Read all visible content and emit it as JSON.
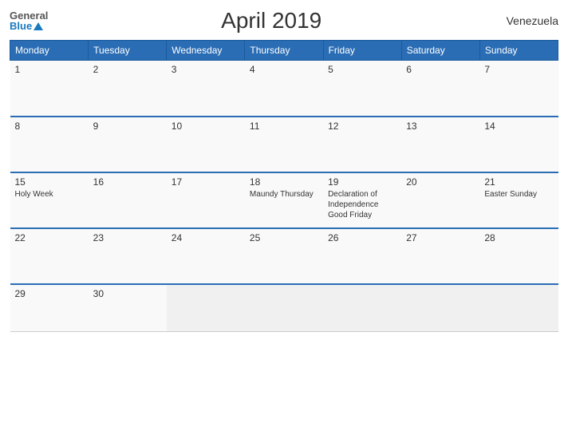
{
  "header": {
    "title": "April 2019",
    "country": "Venezuela"
  },
  "logo": {
    "general": "General",
    "blue": "Blue"
  },
  "days_of_week": [
    "Monday",
    "Tuesday",
    "Wednesday",
    "Thursday",
    "Friday",
    "Saturday",
    "Sunday"
  ],
  "weeks": [
    [
      {
        "day": "1",
        "events": []
      },
      {
        "day": "2",
        "events": []
      },
      {
        "day": "3",
        "events": []
      },
      {
        "day": "4",
        "events": []
      },
      {
        "day": "5",
        "events": []
      },
      {
        "day": "6",
        "events": []
      },
      {
        "day": "7",
        "events": []
      }
    ],
    [
      {
        "day": "8",
        "events": []
      },
      {
        "day": "9",
        "events": []
      },
      {
        "day": "10",
        "events": []
      },
      {
        "day": "11",
        "events": []
      },
      {
        "day": "12",
        "events": []
      },
      {
        "day": "13",
        "events": []
      },
      {
        "day": "14",
        "events": []
      }
    ],
    [
      {
        "day": "15",
        "events": [
          "Holy Week"
        ]
      },
      {
        "day": "16",
        "events": []
      },
      {
        "day": "17",
        "events": []
      },
      {
        "day": "18",
        "events": [
          "Maundy Thursday"
        ]
      },
      {
        "day": "19",
        "events": [
          "Declaration of Independence",
          "Good Friday"
        ]
      },
      {
        "day": "20",
        "events": []
      },
      {
        "day": "21",
        "events": [
          "Easter Sunday"
        ]
      }
    ],
    [
      {
        "day": "22",
        "events": []
      },
      {
        "day": "23",
        "events": []
      },
      {
        "day": "24",
        "events": []
      },
      {
        "day": "25",
        "events": []
      },
      {
        "day": "26",
        "events": []
      },
      {
        "day": "27",
        "events": []
      },
      {
        "day": "28",
        "events": []
      }
    ],
    [
      {
        "day": "29",
        "events": []
      },
      {
        "day": "30",
        "events": []
      },
      {
        "day": "",
        "events": []
      },
      {
        "day": "",
        "events": []
      },
      {
        "day": "",
        "events": []
      },
      {
        "day": "",
        "events": []
      },
      {
        "day": "",
        "events": []
      }
    ]
  ]
}
